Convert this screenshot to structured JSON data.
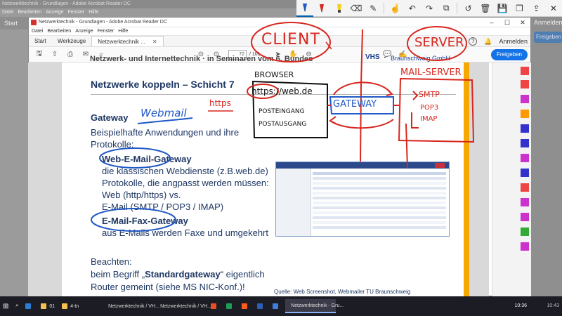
{
  "background_window": {
    "title": "Netzwerktechnik - Grundlagen - Adobe Acrobat Reader DC",
    "menu": [
      "Datei",
      "Bearbeiten",
      "Anzeige",
      "Fenster",
      "Hilfe"
    ],
    "tab_start": "Start",
    "anmelden": "Anmelden",
    "share": "Freigeben"
  },
  "window": {
    "title": "Netzwerktechnik - Grundlagen - Adobe Acrobat Reader DC",
    "menu": [
      "Datei",
      "Bearbeiten",
      "Anzeige",
      "Fenster",
      "Hilfe"
    ],
    "tabs": {
      "start": "Start",
      "tools": "Werkzeuge",
      "doc": "Netzwerktechnik ..."
    },
    "help_icon": "?",
    "anmelden": "Anmelden",
    "page_current": "72",
    "page_total": "/ 101",
    "share_button": "Freigeben"
  },
  "page": {
    "header": "Netzwerk- und Internettechnik  ·  in Seminaren vom 6. Bundes",
    "logo_vhs": "VHS",
    "logo_bs": "Braunschweig GmbH",
    "title": "Netzwerke koppeln – Schicht 7",
    "gateway": "Gateway",
    "intro_1": "Beispielhafte Anwendungen und ihre",
    "intro_2": "Protokolle:",
    "item1_title": "Web-E-Mail-Gateway",
    "item1_l1": "die klassischen Webdienste (z.B.web.de)",
    "item1_l2": "Protokolle, die angpasst werden müssen:",
    "item1_l3": "Web (http/https) vs.",
    "item1_l4": "E-Mail (SMTP / POP3 / IMAP)",
    "item2_title": "E-Mail-Fax-Gateway",
    "item2_l1": "aus E-Mails werden Faxe und umgekehrt",
    "beachten": "Beachten:",
    "note_pre": "beim Begriff „",
    "note_bold": "Standardgateway",
    "note_post": "“ eigentlich",
    "note_l2": "Router gemeint (siehe MS NIC-Konf.)!",
    "caption": "Quelle: Web Screenshot, Webmailer TU Braunschweig"
  },
  "handwriting": {
    "client": "CLIENT",
    "server": "SERVER",
    "mail_server": "MAIL-SERVER",
    "browser": "BROWSER",
    "url": "https://web.de",
    "posteingang": "POSTEINGANG",
    "postausgang": "POSTAUSGANG",
    "gateway": "GATEWAY",
    "smtp": "SMTP",
    "pop3": "POP3",
    "imap": "IMAP",
    "webmail": "Webmail",
    "https": "https"
  },
  "taskbar": {
    "items": [
      "01",
      "4-tn",
      "Netzwerktechnik / VH...",
      "Netzwerktechnik / VH...",
      "Netzwerktechnik - Gru..."
    ],
    "clock": "10:36",
    "clock_bg": "10:43"
  },
  "colors": {
    "ink_red": "#d7261e",
    "ink_blue": "#1f58c7",
    "ink_black": "#111111",
    "heading_blue": "#1f3864",
    "accent_orange": "#f6a800",
    "acrobat_blue": "#1473e6"
  }
}
